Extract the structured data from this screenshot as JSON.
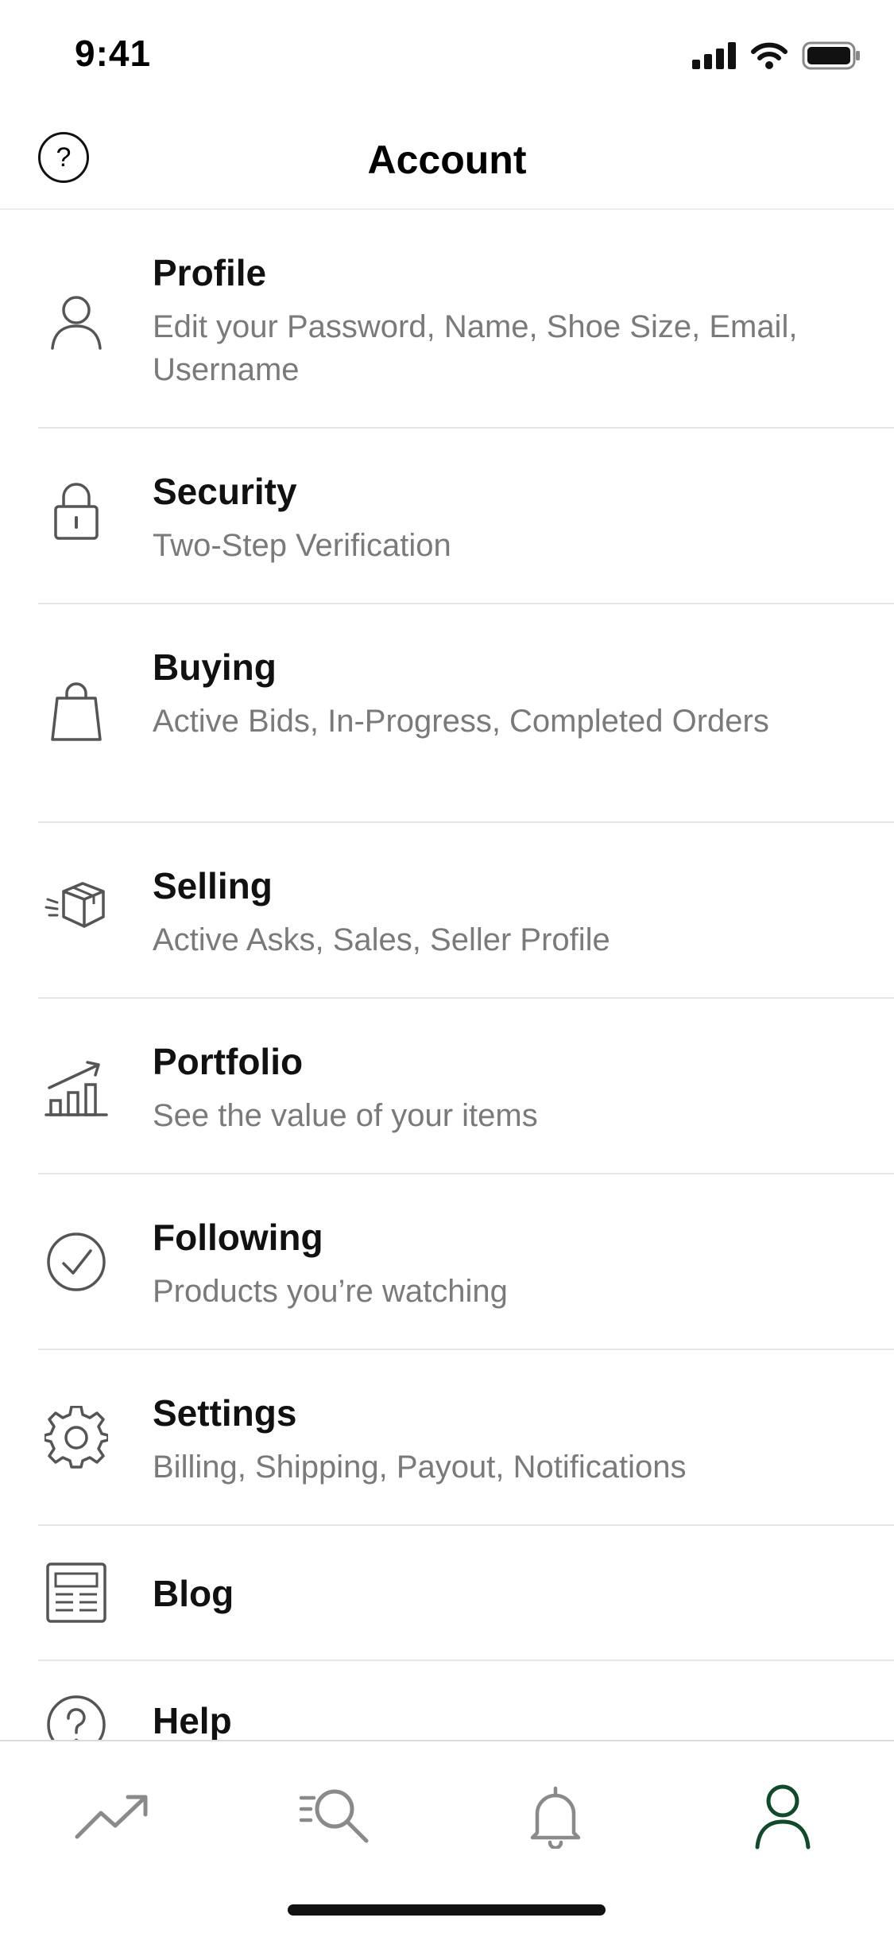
{
  "status_bar": {
    "time": "9:41"
  },
  "header": {
    "title": "Account",
    "help_glyph": "?"
  },
  "menu": [
    {
      "key": "profile",
      "title": "Profile",
      "subtitle": "Edit your Password, Name, Shoe Size, Email, Username",
      "icon": "person-icon"
    },
    {
      "key": "security",
      "title": "Security",
      "subtitle": "Two-Step Verification",
      "icon": "lock-icon"
    },
    {
      "key": "buying",
      "title": "Buying",
      "subtitle": "Active Bids, In-Progress, Completed Orders",
      "icon": "shopping-bag-icon"
    },
    {
      "key": "selling",
      "title": "Selling",
      "subtitle": "Active Asks, Sales, Seller Profile",
      "icon": "box-icon"
    },
    {
      "key": "portfolio",
      "title": "Portfolio",
      "subtitle": "See the value of your items",
      "icon": "bar-chart-icon"
    },
    {
      "key": "following",
      "title": "Following",
      "subtitle": "Products you’re watching",
      "icon": "check-circle-icon"
    },
    {
      "key": "settings",
      "title": "Settings",
      "subtitle": "Billing, Shipping,  Payout, Notifications",
      "icon": "gear-icon"
    },
    {
      "key": "blog",
      "title": "Blog",
      "subtitle": "",
      "icon": "newspaper-icon"
    },
    {
      "key": "help",
      "title": "Help",
      "subtitle": "",
      "icon": "help-circle-icon"
    }
  ],
  "tab_bar": {
    "tabs": [
      {
        "key": "trending",
        "icon": "trending-icon",
        "active": false
      },
      {
        "key": "search",
        "icon": "search-icon",
        "active": false
      },
      {
        "key": "notifications",
        "icon": "bell-icon",
        "active": false
      },
      {
        "key": "account",
        "icon": "person-icon",
        "active": true
      }
    ],
    "active_color": "#0f4a2a",
    "inactive_color": "#8a8a8a"
  },
  "colors": {
    "icon": "#555555",
    "subtitle": "#7a7a7a"
  }
}
